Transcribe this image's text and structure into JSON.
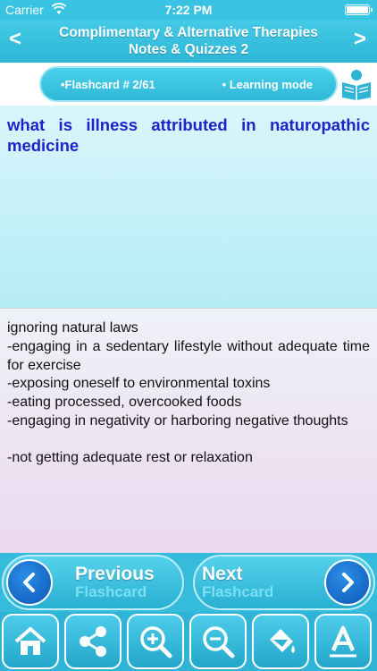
{
  "status_bar": {
    "carrier": "Carrier",
    "time": "7:22 PM"
  },
  "header": {
    "title_line1": "Complimentary & Alternative Therapies",
    "title_line2": "Notes & Quizzes 2",
    "prev_arrow": "<",
    "next_arrow": ">"
  },
  "mode_bar": {
    "flashcard_label": "•Flashcard #  2/61",
    "mode_label": "• Learning mode",
    "icon": "reader-icon"
  },
  "question": {
    "text": "what is illness attributed in naturopathic medicine"
  },
  "answer": {
    "lines": [
      "ignoring natural laws",
      "  -engaging in a sedentary lifestyle without adequate time for exercise",
      " -exposing oneself to environmental toxins",
      " -eating processed, overcooked foods",
      "  -engaging in negativity or harboring negative thoughts",
      " -not getting adequate rest or relaxation"
    ]
  },
  "footer_nav": {
    "prev_big": "Previous",
    "prev_small": "Flashcard",
    "next_big": "Next",
    "next_small": "Flashcard"
  },
  "toolbar": {
    "items": [
      "home-icon",
      "share-icon",
      "zoom-in-icon",
      "zoom-out-icon",
      "paint-bucket-icon",
      "font-icon"
    ]
  },
  "colors": {
    "accent": "#3cc6e2",
    "question_text": "#1e22c8",
    "nav_circle": "#0e56b8"
  }
}
